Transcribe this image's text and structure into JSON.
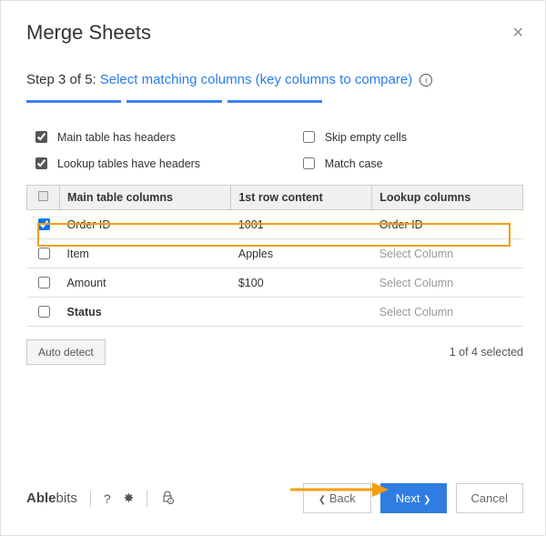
{
  "header": {
    "title": "Merge Sheets"
  },
  "step": {
    "prefix": "Step 3 of 5:",
    "text": "Select matching columns (key columns to compare)"
  },
  "options": {
    "main_headers": "Main table has headers",
    "skip_empty": "Skip empty cells",
    "lookup_headers": "Lookup tables have headers",
    "match_case": "Match case"
  },
  "table": {
    "headers": {
      "main": "Main table columns",
      "first": "1st row content",
      "lookup": "Lookup columns"
    },
    "rows": [
      {
        "col": "Order ID",
        "first": "1001",
        "lookup": "Order ID",
        "checked": true,
        "lookup_selected": true
      },
      {
        "col": "Item",
        "first": "Apples",
        "lookup": "Select Column",
        "checked": false,
        "lookup_selected": false
      },
      {
        "col": "Amount",
        "first": "$100",
        "lookup": "Select Column",
        "checked": false,
        "lookup_selected": false
      },
      {
        "col": "Status",
        "first": "",
        "lookup": "Select Column",
        "checked": false,
        "lookup_selected": false,
        "bold": true
      }
    ]
  },
  "auto_detect": "Auto detect",
  "selection_count": "1 of 4 selected",
  "brand": {
    "part1": "Able",
    "part2": "bits"
  },
  "buttons": {
    "back": "Back",
    "next": "Next",
    "cancel": "Cancel"
  }
}
